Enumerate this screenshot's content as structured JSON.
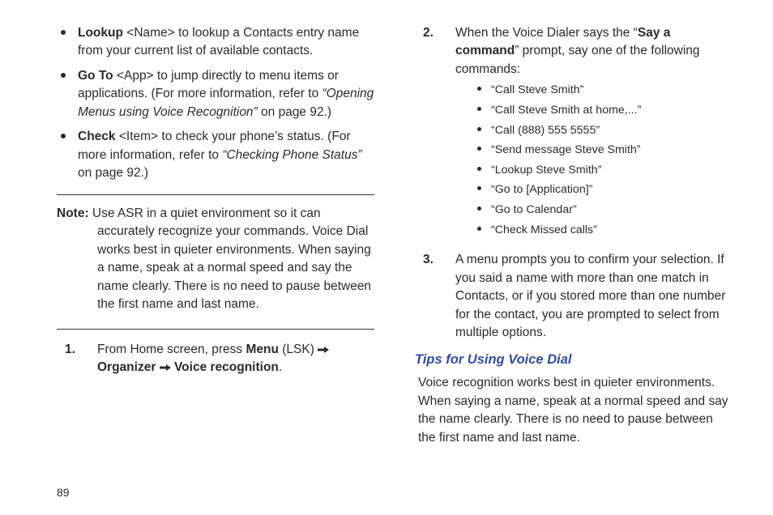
{
  "left": {
    "bullets": [
      {
        "lead": "Lookup",
        "after": " <Name> to lookup a Contacts entry name from your current list of available contacts."
      },
      {
        "lead": "Go To",
        "after": " <App> to jump directly to menu items or applications. (For more information, refer to ",
        "linkText": "“Opening Menus using Voice Recognition”",
        "tail": " on page 92.)"
      },
      {
        "lead": "Check",
        "after": " <Item> to check your phone’s status. (For more information, refer to ",
        "linkText": "“Checking Phone Status”",
        "tail": " on page 92.)"
      }
    ],
    "note_label": "Note:",
    "note_body": " Use ASR in a quiet environment so it can accurately recognize your commands. Voice Dial works best in quieter environments. When saying a name, speak at a normal speed and say the name clearly. There is no need to pause between the first name and last name.",
    "step1_num": "1.",
    "step1_pre": "From Home screen, press ",
    "step1_menu": "Menu",
    "step1_lsk": " (LSK) ",
    "step1_organizer": "Organizer",
    "step1_voice": "Voice recognition",
    "step1_period": "."
  },
  "right": {
    "step2_num": "2.",
    "step2_a": "When the Voice Dialer says the “",
    "step2_cmd": "Say a command",
    "step2_b": "” prompt, say one of the following commands:",
    "sub": [
      "“Call Steve Smith”",
      "“Call Steve Smith at home,...”",
      "“Call (888) 555 5555”",
      "“Send message Steve Smith”",
      "“Lookup Steve Smith”",
      "“Go to [Application]”",
      "“Go to Calendar”",
      "“Check Missed calls”"
    ],
    "step3_num": "3.",
    "step3_body": "A menu prompts you to confirm your selection. If you said a name with more than one match in Contacts, or if you stored more than one number for the contact, you are prompted to select from multiple options.",
    "tips_heading": "Tips for Using Voice Dial",
    "tips_body": "Voice recognition works best in quieter environments. When saying a name, speak at a normal speed and say the name clearly. There is no need to pause between the first name and last name."
  },
  "pageno": "89"
}
